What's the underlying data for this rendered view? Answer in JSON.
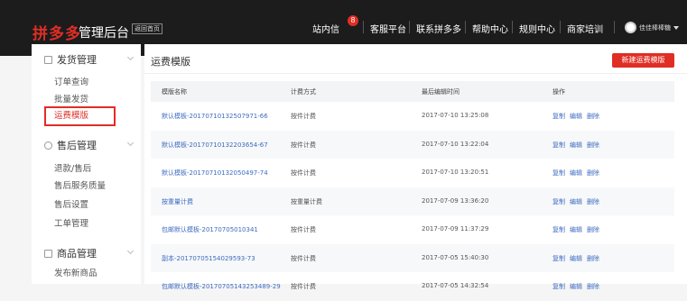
{
  "topbar": {
    "logo": "拼多多",
    "subtitle": "管理后台",
    "home_tag": "返回首页",
    "message_badge": "8",
    "nav": [
      "站内信",
      "客服平台",
      "联系拼多多",
      "帮助中心",
      "规则中心",
      "商家培训"
    ],
    "user_name": "佳佳棒棒糖"
  },
  "sidebar": {
    "sections": [
      {
        "title": "发货管理",
        "icon": "document-icon",
        "items": [
          "订单查询",
          "批量发货",
          "运费模版"
        ]
      },
      {
        "title": "售后管理",
        "icon": "service-icon",
        "items": [
          "退款/售后",
          "售后服务质量",
          "售后设置",
          "工单管理"
        ]
      },
      {
        "title": "商品管理",
        "icon": "bag-icon",
        "items": [
          "发布新商品"
        ]
      }
    ],
    "active_item": "运费模版"
  },
  "main": {
    "title": "运费模版",
    "new_button": "新建运费模版",
    "columns": [
      "模版名称",
      "计费方式",
      "最后编辑时间",
      "操作"
    ],
    "actions": [
      "复制",
      "编辑",
      "删除"
    ],
    "rows": [
      {
        "name": "默认模板-20170710132507971-66",
        "billing": "按件计费",
        "time": "2017-07-10 13:25:08"
      },
      {
        "name": "默认模板-20170710132203654-67",
        "billing": "按件计费",
        "time": "2017-07-10 13:22:04"
      },
      {
        "name": "默认模板-20170710132050497-74",
        "billing": "按件计费",
        "time": "2017-07-10 13:20:51"
      },
      {
        "name": "按重量计费",
        "billing": "按重量计费",
        "time": "2017-07-09 13:36:20"
      },
      {
        "name": "包邮默认模板-20170705010341",
        "billing": "按件计费",
        "time": "2017-07-09 11:37:29"
      },
      {
        "name": "副本-20170705154029593-73",
        "billing": "按件计费",
        "time": "2017-07-05 15:40:30"
      },
      {
        "name": "包邮默认模板-20170705143253489-29",
        "billing": "按件计费",
        "time": "2017-07-05 14:32:54"
      }
    ]
  }
}
